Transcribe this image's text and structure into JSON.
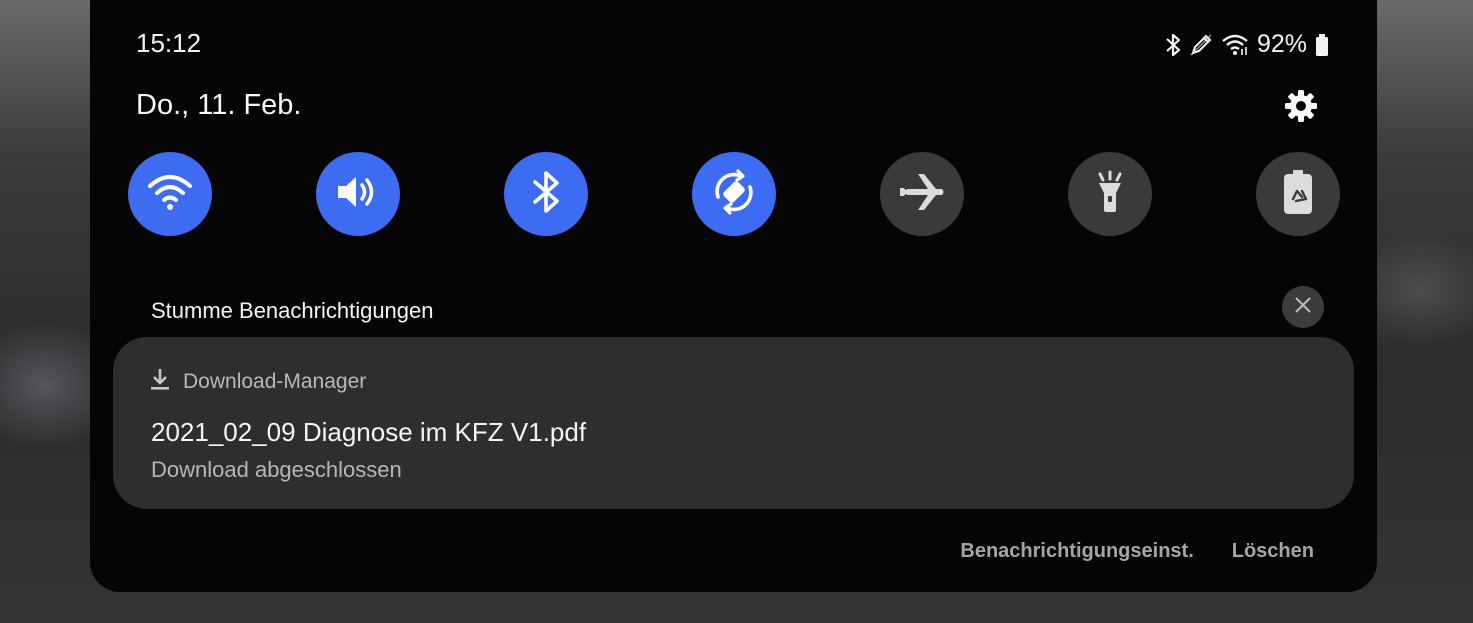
{
  "status_bar": {
    "time": "15:12",
    "battery_percent": "92%",
    "icons": [
      "bluetooth-icon",
      "stylus-icon",
      "wifi-icon",
      "battery-icon"
    ]
  },
  "header": {
    "date": "Do., 11. Feb.",
    "settings_icon": "gear-icon"
  },
  "quick_settings": [
    {
      "name": "wifi",
      "icon": "wifi-icon",
      "active": true
    },
    {
      "name": "sound",
      "icon": "speaker-icon",
      "active": true
    },
    {
      "name": "bluetooth",
      "icon": "bluetooth-icon",
      "active": true
    },
    {
      "name": "auto-rotate",
      "icon": "rotate-icon",
      "active": true
    },
    {
      "name": "airplane-mode",
      "icon": "airplane-icon",
      "active": false
    },
    {
      "name": "flashlight",
      "icon": "flashlight-icon",
      "active": false
    },
    {
      "name": "power-saving",
      "icon": "battery-recycle-icon",
      "active": false
    }
  ],
  "section": {
    "title": "Stumme Benachrichtigungen"
  },
  "notification": {
    "app_name": "Download-Manager",
    "title": "2021_02_09 Diagnose im KFZ V1.pdf",
    "text": "Download abgeschlossen"
  },
  "footer": {
    "settings_label": "Benachrichtigungseinst.",
    "clear_label": "Löschen"
  },
  "colors": {
    "accent": "#3d6cf2",
    "panel": "#050505",
    "card": "#2e2e2e",
    "inactive": "#3a3a3a"
  }
}
